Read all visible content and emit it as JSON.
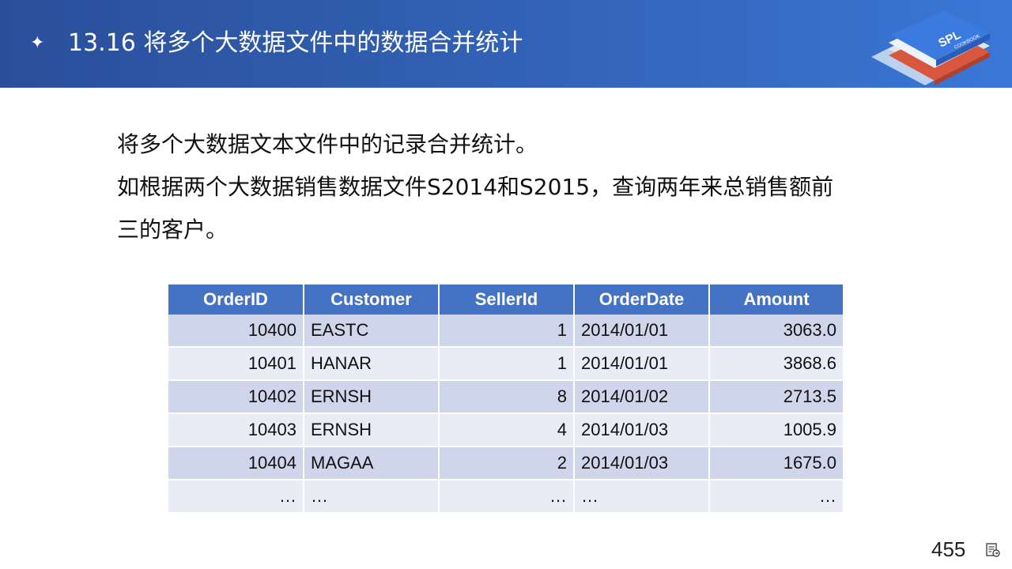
{
  "header": {
    "bullet": "✦",
    "title": "13.16 将多个大数据文件中的数据合并统计"
  },
  "logo": {
    "text": "SPL",
    "subtext": "COOKBOOK"
  },
  "body": {
    "lines": [
      "将多个大数据文本文件中的记录合并统计。",
      "如根据两个大数据销售数据文件S2014和S2015，查询两年来总销售额前",
      "三的客户。"
    ]
  },
  "table": {
    "columns": [
      "OrderID",
      "Customer",
      "SellerId",
      "OrderDate",
      "Amount"
    ],
    "rows": [
      [
        "10400",
        "EASTC",
        "1",
        "2014/01/01",
        "3063.0"
      ],
      [
        "10401",
        "HANAR",
        "1",
        "2014/01/01",
        "3868.6"
      ],
      [
        "10402",
        "ERNSH",
        "8",
        "2014/01/02",
        "2713.5"
      ],
      [
        "10403",
        "ERNSH",
        "4",
        "2014/01/03",
        "1005.9"
      ],
      [
        "10404",
        "MAGAA",
        "2",
        "2014/01/03",
        "1675.0"
      ],
      [
        "…",
        "…",
        "…",
        "…",
        "…"
      ]
    ]
  },
  "footer": {
    "page_number": "455"
  },
  "colors": {
    "header": "#3363b8",
    "table_header": "#4472c4",
    "row_dark": "#cfd5ea",
    "row_light": "#e9ebf5"
  }
}
